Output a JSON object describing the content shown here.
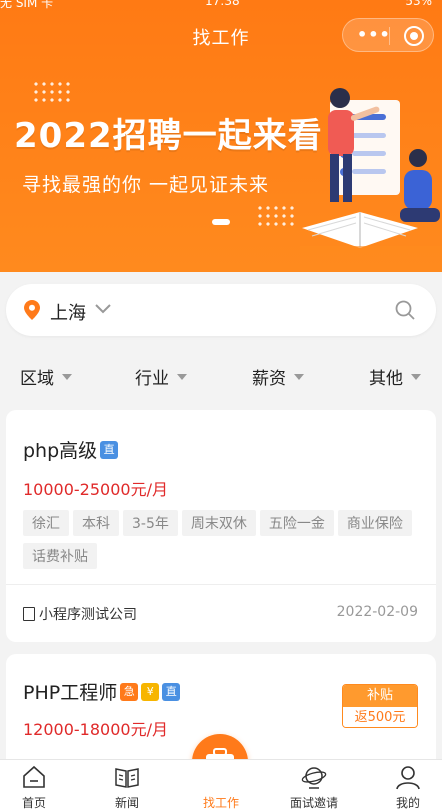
{
  "status": {
    "carrier": "无 SIM 卡",
    "time": "17:38",
    "battery": "53%"
  },
  "nav": {
    "title": "找工作"
  },
  "banner": {
    "headline": "2022招聘一起来看",
    "subtitle": "寻找最强的你 一起见证未来"
  },
  "search": {
    "city": "上海"
  },
  "filters": [
    {
      "label": "区域"
    },
    {
      "label": "行业"
    },
    {
      "label": "薪资"
    },
    {
      "label": "其他"
    }
  ],
  "jobs": [
    {
      "title": "php高级",
      "badges": [
        "直"
      ],
      "salary": "10000-25000元/月",
      "tags": [
        "徐汇",
        "本科",
        "3-5年",
        "周末双休",
        "五险一金",
        "商业保险",
        "话费补贴"
      ],
      "company": "小程序测试公司",
      "date": "2022-02-09"
    },
    {
      "title": "PHP工程师",
      "badges": [
        "急",
        "¥",
        "直"
      ],
      "salary": "12000-18000元/月",
      "subsidy": {
        "label": "补贴",
        "amount": "返500元"
      }
    }
  ],
  "tabs": [
    {
      "label": "首页",
      "icon": "home-icon"
    },
    {
      "label": "新闻",
      "icon": "news-icon"
    },
    {
      "label": "找工作",
      "icon": "briefcase-icon",
      "active": true
    },
    {
      "label": "面试邀请",
      "icon": "interview-icon"
    },
    {
      "label": "我的",
      "icon": "profile-icon"
    }
  ],
  "colors": {
    "brand": "#ff7a1a",
    "salary": "#e02a2a",
    "badge_blue": "#4a90e2",
    "badge_yellow": "#f7b500"
  }
}
